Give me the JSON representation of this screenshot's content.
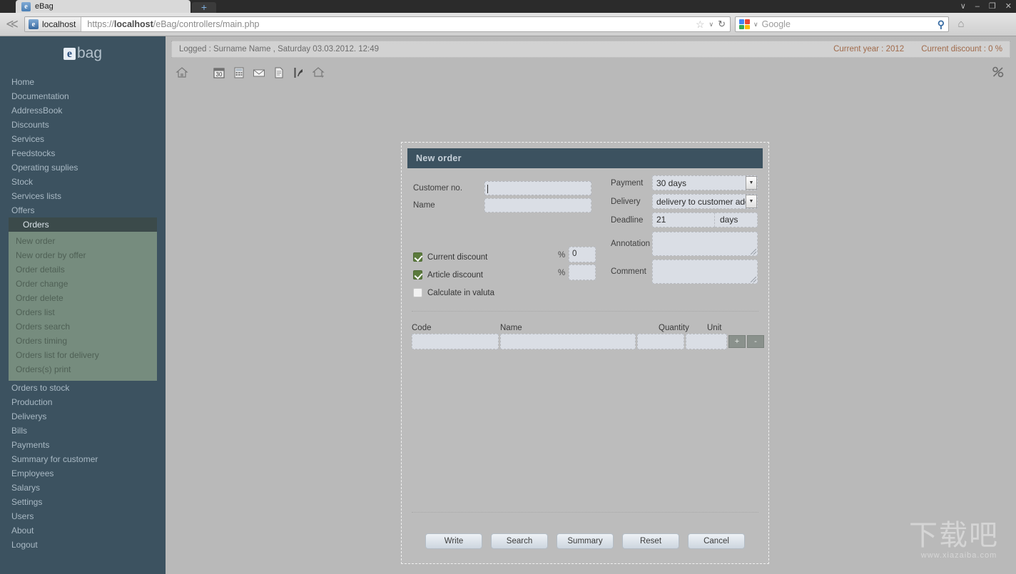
{
  "browser": {
    "tab_title": "eBag",
    "tab_favicon": "e",
    "new_tab_label": "+",
    "window_controls": {
      "chevron": "∨",
      "minimize": "–",
      "maximize": "❐",
      "close": "✕"
    },
    "back_icon": "≪",
    "site_identity": "localhost",
    "site_favicon": "e",
    "url_prefix": "https://",
    "url_host": "localhost",
    "url_path": "/eBag/controllers/main.php",
    "star_icon": "☆",
    "dropdown_icon": "∨",
    "reload_icon": "↻",
    "search_placeholder": "Google",
    "search_icon": "⚲",
    "home_icon": "⌂"
  },
  "sidebar": {
    "logo_mark": "e",
    "logo_text": "bag",
    "items": [
      {
        "label": "Home"
      },
      {
        "label": "Documentation"
      },
      {
        "label": "AddressBook"
      },
      {
        "label": "Discounts"
      },
      {
        "label": "Services"
      },
      {
        "label": "Feedstocks"
      },
      {
        "label": "Operating suplies"
      },
      {
        "label": "Stock"
      },
      {
        "label": "Services lists"
      },
      {
        "label": "Offers"
      }
    ],
    "active_item": "Orders",
    "submenu": [
      {
        "label": "New order"
      },
      {
        "label": "New order by offer"
      },
      {
        "label": "Order details"
      },
      {
        "label": "Order change"
      },
      {
        "label": "Order delete"
      },
      {
        "label": "Orders list"
      },
      {
        "label": "Orders search"
      },
      {
        "label": "Orders timing"
      },
      {
        "label": "Orders list for delivery"
      },
      {
        "label": "Orders(s) print"
      }
    ],
    "items_after": [
      {
        "label": "Orders to stock"
      },
      {
        "label": "Production"
      },
      {
        "label": "Deliverys"
      },
      {
        "label": "Bills"
      },
      {
        "label": "Payments"
      },
      {
        "label": "Summary for customer"
      },
      {
        "label": "Employees"
      },
      {
        "label": "Salarys"
      },
      {
        "label": "Settings"
      },
      {
        "label": "Users"
      },
      {
        "label": "About"
      },
      {
        "label": "Logout"
      }
    ]
  },
  "statusbar": {
    "logged_text": "Logged :  Surname Name  ,  Saturday 03.03.2012. 12:49",
    "current_year_label": "Current year :",
    "current_year_value": "2012",
    "current_discount_label": "Current discount :",
    "current_discount_value": "0",
    "percent_symbol": "%",
    "accent_color": "#a06a4a"
  },
  "toolbar": {
    "icons": [
      {
        "name": "home-icon"
      },
      {
        "name": "calendar-icon",
        "badge": "30"
      },
      {
        "name": "calculator-icon"
      },
      {
        "name": "mail-icon"
      },
      {
        "name": "document-icon"
      },
      {
        "name": "chart-icon"
      },
      {
        "name": "home-export-icon"
      }
    ],
    "corner_icon": "percent-icon"
  },
  "panel": {
    "title": "New order",
    "header_bg": "#3c5260",
    "customer_no_label": "Customer no.",
    "customer_no_value": "",
    "name_label": "Name",
    "name_value": "",
    "checkboxes": [
      {
        "label": "Current discount",
        "checked": true
      },
      {
        "label": "Article discount",
        "checked": true
      },
      {
        "label": "Calculate in valuta",
        "checked": false
      }
    ],
    "percent_sign": "%",
    "current_discount_pct": "0",
    "article_discount_pct": "",
    "payment_label": "Payment",
    "payment_value": "30 days",
    "delivery_label": "Delivery",
    "delivery_value": "delivery to customer add",
    "deadline_label": "Deadline",
    "deadline_value": "21",
    "deadline_unit": "days",
    "annotation_label": "Annotation",
    "annotation_value": "",
    "comment_label": "Comment",
    "comment_value": "",
    "table_headers": [
      "Code",
      "Name",
      "Quantity",
      "Unit"
    ],
    "table_row": {
      "code": "",
      "name": "",
      "quantity": "",
      "unit": ""
    },
    "add_button": "+",
    "remove_button": "-",
    "buttons": [
      {
        "label": "Write"
      },
      {
        "label": "Search"
      },
      {
        "label": "Summary"
      },
      {
        "label": "Reset"
      },
      {
        "label": "Cancel"
      }
    ]
  },
  "watermark": {
    "text": "下载吧",
    "url": "www.xiazaiba.com"
  }
}
